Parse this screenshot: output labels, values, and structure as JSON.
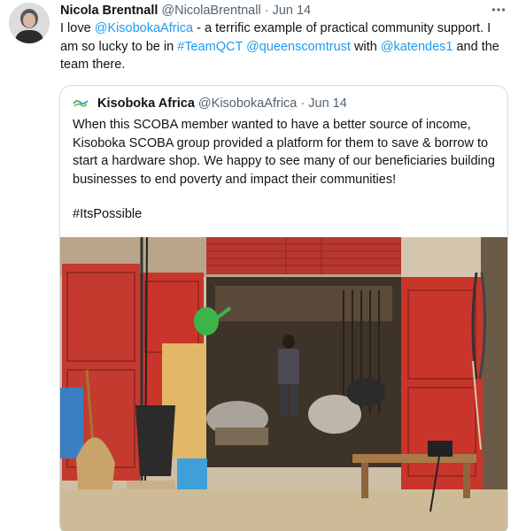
{
  "tweet": {
    "author_name": "Nicola Brentnall",
    "author_handle": "@NicolaBrentnall",
    "separator": "·",
    "date": "Jun 14",
    "more_icon": "more-dots-icon",
    "text_parts": {
      "p1": "I love ",
      "mention1": "@KisobokaAfrica",
      "p2": " - a terrific example of practical community support. I am so lucky to be in ",
      "hashtag1": "#TeamQCT",
      "p3": " ",
      "mention2": "@queenscomtrust",
      "p4": " with ",
      "mention3": "@katendes1",
      "p5": " and the team there."
    }
  },
  "quoted": {
    "author_name": "Kisoboka Africa",
    "author_handle": "@KisobokaAfrica",
    "separator": "·",
    "date": "Jun 14",
    "text": "When this SCOBA member wanted to have a better  source of income, Kisoboka SCOBA group provided a platform for them to save & borrow to start a hardware shop. We happy to see many of our beneficiaries building businesses to end poverty and impact their communities!",
    "hashtag": "#ItsPossible"
  },
  "colors": {
    "link": "#1d9bf0",
    "secondary_text": "#536471",
    "border": "#cfd9de",
    "shop_door_red": "#c9352b"
  }
}
